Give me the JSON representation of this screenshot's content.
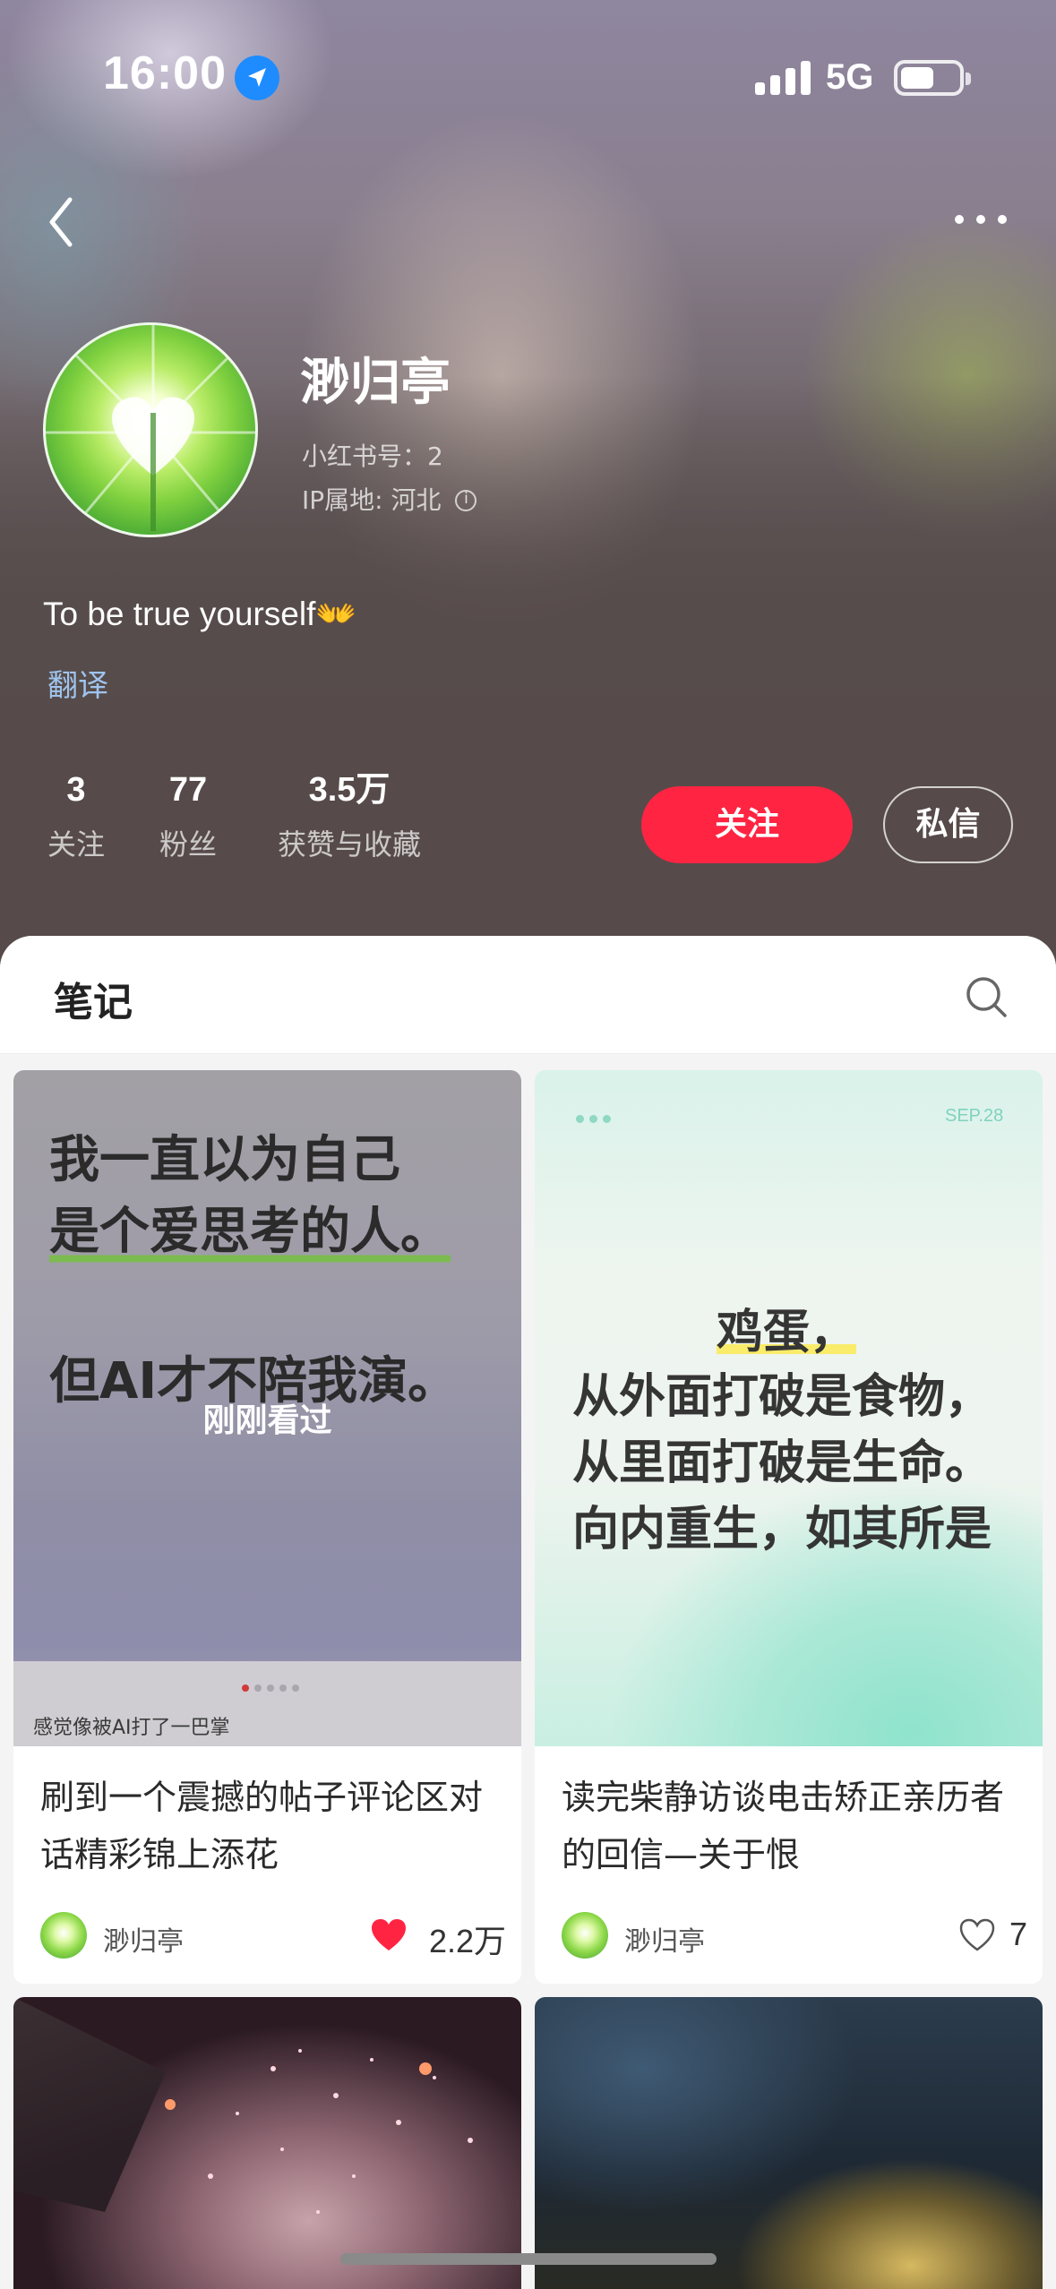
{
  "status_bar": {
    "time": "16:00",
    "network": "5G"
  },
  "profile": {
    "name": "渺归亭",
    "id_line": "小红书号：2",
    "ip_line": "IP属地: 河北",
    "bio": "To be true yourself👐",
    "translate": "翻译",
    "stats": [
      {
        "num": "3",
        "label": "关注"
      },
      {
        "num": "77",
        "label": "粉丝"
      },
      {
        "num": "3.5万",
        "label": "获赞与收藏"
      }
    ],
    "follow_label": "关注",
    "message_label": "私信"
  },
  "tabs": {
    "notes_label": "笔记"
  },
  "colors": {
    "accent": "#ff2442",
    "link": "#9fc4ee"
  },
  "notes": [
    {
      "cover_lines": [
        "我一直以为自己",
        "是个爱思考的人。",
        "但AI才不陪我演。"
      ],
      "cover_caption": "感觉像被AI打了一巴掌",
      "viewed_label": "刚刚看过",
      "title": "刷到一个震撼的帖子评论区对话精彩锦上添花",
      "author": "渺归亭",
      "likes": "2.2万",
      "liked": true
    },
    {
      "cover_date": "SEP.28",
      "cover_lines": [
        "鸡蛋，",
        "从外面打破是食物，",
        "从里面打破是生命。",
        "向内重生，如其所是"
      ],
      "title": "读完柴静访谈电击矫正亲历者的回信—关于恨",
      "author": "渺归亭",
      "likes": "7",
      "liked": false
    }
  ]
}
